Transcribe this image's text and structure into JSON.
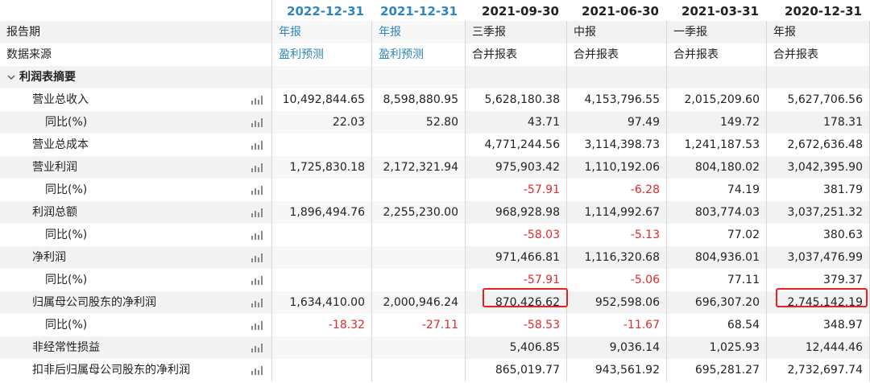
{
  "header": {
    "dates": [
      "2022-12-31",
      "2021-12-31",
      "2021-09-30",
      "2021-06-30",
      "2021-03-31",
      "2020-12-31"
    ]
  },
  "report_period": {
    "label": "报告期",
    "values": [
      "年报",
      "年报",
      "三季报",
      "中报",
      "一季报",
      "年报"
    ]
  },
  "data_source": {
    "label": "数据来源",
    "values": [
      "盈利预测",
      "盈利预测",
      "合并报表",
      "合并报表",
      "合并报表",
      "合并报表"
    ]
  },
  "section": {
    "label": "利润表摘要"
  },
  "rows": [
    {
      "label": "营业总收入",
      "indent": 1,
      "values": [
        "10,492,844.65",
        "8,598,880.95",
        "5,628,180.38",
        "4,153,796.55",
        "2,015,209.60",
        "5,627,706.56"
      ]
    },
    {
      "label": "同比(%)",
      "indent": 2,
      "values": [
        "22.03",
        "52.80",
        "43.71",
        "97.49",
        "149.72",
        "178.31"
      ]
    },
    {
      "label": "营业总成本",
      "indent": 1,
      "values": [
        "",
        "",
        "4,771,244.56",
        "3,114,398.73",
        "1,241,187.53",
        "2,672,636.48"
      ]
    },
    {
      "label": "营业利润",
      "indent": 1,
      "values": [
        "1,725,830.18",
        "2,172,321.94",
        "975,903.42",
        "1,110,192.06",
        "804,180.02",
        "3,042,395.90"
      ]
    },
    {
      "label": "同比(%)",
      "indent": 2,
      "values": [
        "",
        "",
        "-57.91",
        "-6.28",
        "74.19",
        "381.79"
      ]
    },
    {
      "label": "利润总额",
      "indent": 1,
      "values": [
        "1,896,494.76",
        "2,255,230.00",
        "968,928.98",
        "1,114,992.67",
        "803,774.03",
        "3,037,251.32"
      ]
    },
    {
      "label": "同比(%)",
      "indent": 2,
      "values": [
        "",
        "",
        "-58.03",
        "-5.13",
        "77.02",
        "380.63"
      ]
    },
    {
      "label": "净利润",
      "indent": 1,
      "values": [
        "",
        "",
        "971,466.81",
        "1,116,320.68",
        "804,936.01",
        "3,037,476.99"
      ]
    },
    {
      "label": "同比(%)",
      "indent": 2,
      "values": [
        "",
        "",
        "-57.91",
        "-5.06",
        "77.11",
        "379.37"
      ]
    },
    {
      "label": "归属母公司股东的净利润",
      "indent": 1,
      "values": [
        "1,634,410.00",
        "2,000,946.24",
        "870,426.62",
        "952,598.06",
        "696,307.20",
        "2,745,142.19"
      ]
    },
    {
      "label": "同比(%)",
      "indent": 2,
      "values": [
        "-18.32",
        "-27.11",
        "-58.53",
        "-11.67",
        "68.54",
        "348.97"
      ]
    },
    {
      "label": "非经常性损益",
      "indent": 1,
      "values": [
        "",
        "",
        "5,406.85",
        "9,036.14",
        "1,025.93",
        "12,444.46"
      ]
    },
    {
      "label": "扣非后归属母公司股东的净利润",
      "indent": 1,
      "values": [
        "",
        "",
        "865,019.77",
        "943,561.92",
        "695,281.27",
        "2,732,697.74"
      ]
    }
  ],
  "colors": {
    "accent": "#2e86c1",
    "negative": "#e02b2b",
    "highlight": "#e52121"
  },
  "icons": {
    "row_chart": "bar-chart-icon",
    "section_toggle": "chevron-down-icon"
  }
}
